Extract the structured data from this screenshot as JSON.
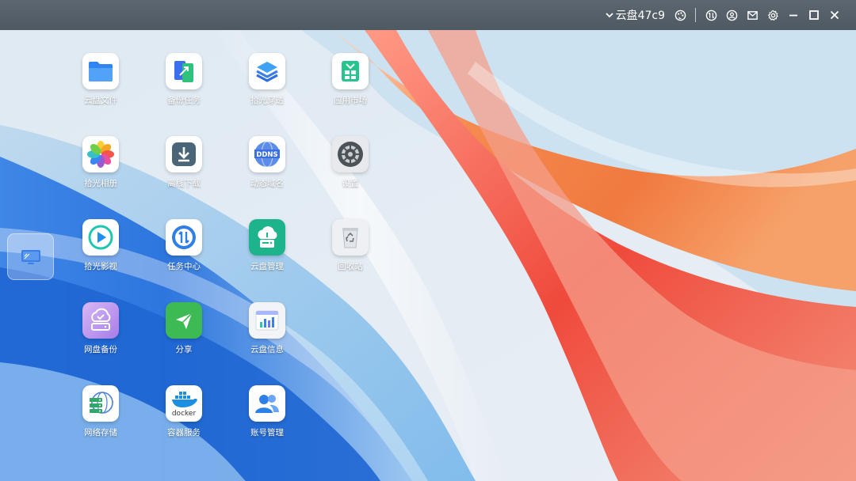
{
  "titlebar": {
    "device_name": "云盘47c9",
    "icons": [
      "chevron-down-icon",
      "theme-icon",
      "transfer-icon",
      "user-icon",
      "mail-icon",
      "gear-icon",
      "minimize-icon",
      "maximize-icon",
      "close-icon"
    ]
  },
  "desktop": {
    "apps": [
      {
        "label": "云盘文件",
        "icon": "folder-icon"
      },
      {
        "label": "备份任务",
        "icon": "backup-icon"
      },
      {
        "label": "拾光穿透",
        "icon": "layers-icon"
      },
      {
        "label": "应用市场",
        "icon": "market-icon"
      },
      {
        "label": "拾光相册",
        "icon": "photos-icon"
      },
      {
        "label": "离线下载",
        "icon": "download-icon"
      },
      {
        "label": "动态域名",
        "icon": "ddns-icon"
      },
      {
        "label": "设置",
        "icon": "settings-icon"
      },
      {
        "label": "拾光影视",
        "icon": "video-icon"
      },
      {
        "label": "任务中心",
        "icon": "task-center-icon"
      },
      {
        "label": "云盘管理",
        "icon": "cloud-manage-icon"
      },
      {
        "label": "回收站",
        "icon": "recycle-bin-icon"
      },
      {
        "label": "网盘备份",
        "icon": "netdisk-backup-icon"
      },
      {
        "label": "分享",
        "icon": "share-icon"
      },
      {
        "label": "云盘信息",
        "icon": "cloud-info-icon"
      },
      {
        "label": "网络存储",
        "icon": "network-storage-icon"
      },
      {
        "label": "容器服务",
        "icon": "docker-icon"
      },
      {
        "label": "账号管理",
        "icon": "account-icon"
      }
    ],
    "docker_text": "docker",
    "ddns_text": "DDNS"
  },
  "colors": {
    "titlebar": "#535d66",
    "accent_blue": "#2e7ef0",
    "accent_orange": "#f07a45"
  }
}
